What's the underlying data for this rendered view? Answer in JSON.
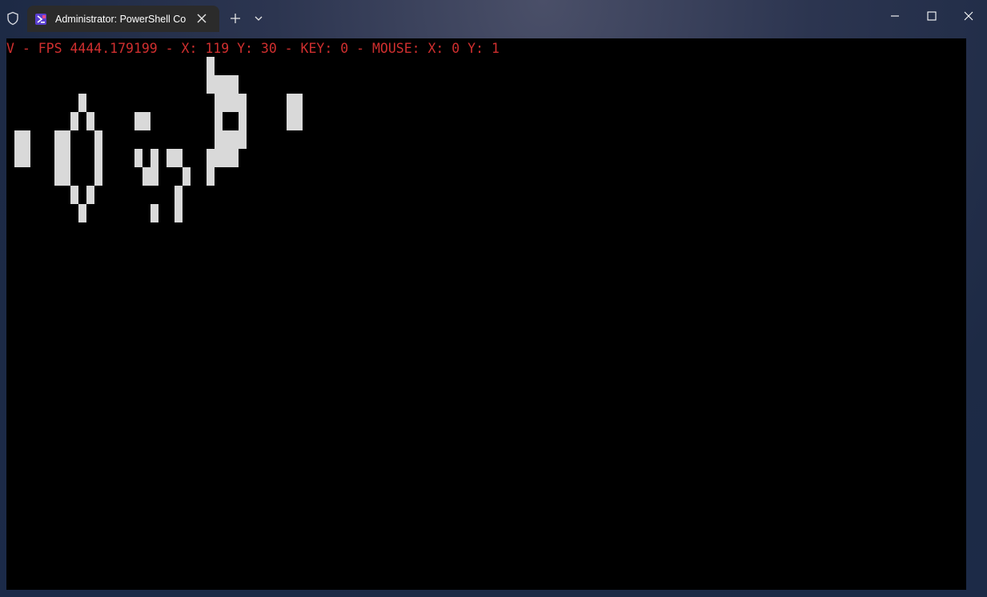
{
  "window": {
    "tab_title": "Administrator: PowerShell Co",
    "tab_icon": "powershell-icon",
    "buttons": [
      "minimize-icon",
      "maximize-icon",
      "close-icon"
    ],
    "accent": "#2b2b2b"
  },
  "console": {
    "status_line": "V - FPS 4444.179199 - X: 119 Y: 30 - KEY: 0 - MOUSE: X: 0 Y: 1",
    "status_color": "#d02f2f",
    "background": "#000000",
    "block_color": "#d9d9d9"
  }
}
